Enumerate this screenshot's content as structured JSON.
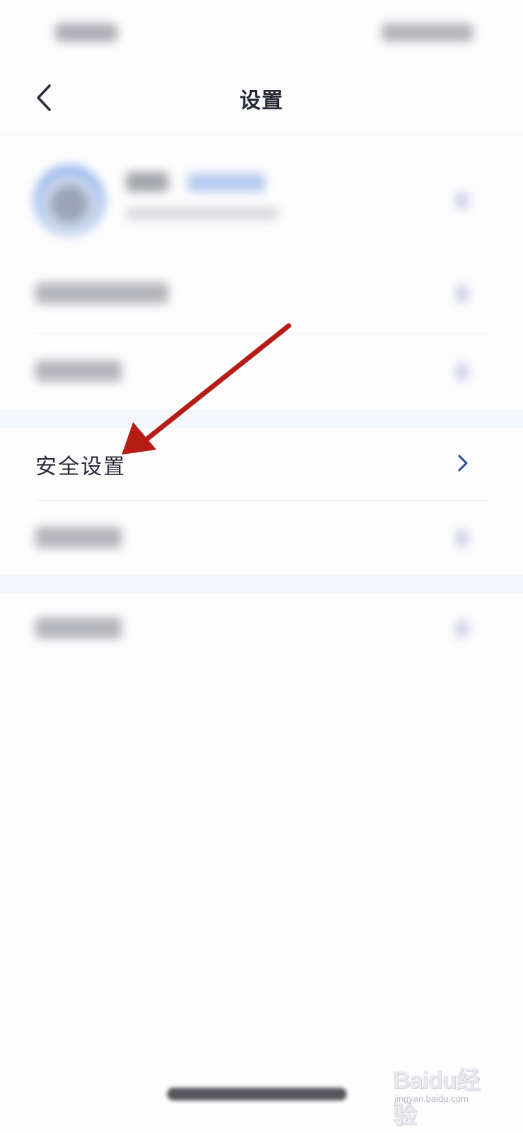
{
  "header": {
    "title": "设置"
  },
  "menu": {
    "security": {
      "label": "安全设置"
    }
  },
  "watermark": {
    "logo": "Baidu经验",
    "url": "jingyan.baidu.com"
  },
  "colors": {
    "annotation_arrow": "#b51d16",
    "chevron": "#2e4a8f",
    "section_gap": "#f4f7fb"
  }
}
